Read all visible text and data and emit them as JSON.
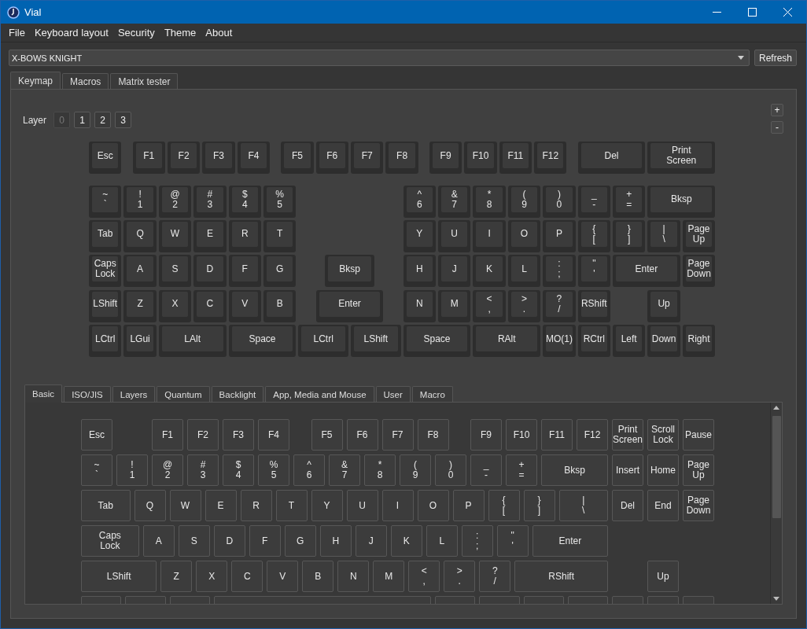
{
  "window": {
    "title": "Vial"
  },
  "menu": [
    "File",
    "Keyboard layout",
    "Security",
    "Theme",
    "About"
  ],
  "keyboard_select": {
    "value": "X-BOWS KNIGHT"
  },
  "refresh_button": "Refresh",
  "tabs": [
    {
      "label": "Keymap",
      "selected": true
    },
    {
      "label": "Macros",
      "selected": false
    },
    {
      "label": "Matrix tester",
      "selected": false
    }
  ],
  "layer_label": "Layer",
  "layers": [
    {
      "label": "0",
      "selected": true
    },
    {
      "label": "1",
      "selected": false
    },
    {
      "label": "2",
      "selected": false
    },
    {
      "label": "3",
      "selected": false
    }
  ],
  "layer_buttons": [
    "+",
    "-"
  ],
  "keymap": [
    [
      "Esc",
      "F1",
      "F2",
      "F3",
      "F4",
      "F5",
      "F6",
      "F7",
      "F8",
      "F9",
      "F10",
      "F11",
      "F12",
      "Del",
      "Print\nScreen"
    ],
    [
      "~\n`",
      "!\n1",
      "@\n2",
      "#\n3",
      "$\n4",
      "%\n5",
      "^\n6",
      "&\n7",
      "*\n8",
      "(\n9",
      ")\n0",
      "_\n-",
      "+\n=",
      "Bksp"
    ],
    [
      "Tab",
      "Q",
      "W",
      "E",
      "R",
      "T",
      "Y",
      "U",
      "I",
      "O",
      "P",
      "{\n[",
      "}\n]",
      "|\n\\",
      "Page\nUp"
    ],
    [
      "Caps\nLock",
      "A",
      "S",
      "D",
      "F",
      "G",
      "Bksp",
      "H",
      "J",
      "K",
      "L",
      ":\n;",
      "\"\n'",
      "Enter",
      "Page\nDown"
    ],
    [
      "LShift",
      "Z",
      "X",
      "C",
      "V",
      "B",
      "Enter",
      "N",
      "M",
      "<\n,",
      ">\n.",
      "?\n/",
      "RShift",
      "Up"
    ],
    [
      "LCtrl",
      "LGui",
      "LAlt",
      "Space",
      "LCtrl",
      "LShift",
      "Space",
      "RAlt",
      "MO(1)",
      "RCtrl",
      "Left",
      "Down",
      "Right"
    ]
  ],
  "keycode_tabs": [
    {
      "label": "Basic",
      "selected": true
    },
    {
      "label": "ISO/JIS",
      "selected": false
    },
    {
      "label": "Layers",
      "selected": false
    },
    {
      "label": "Quantum",
      "selected": false
    },
    {
      "label": "Backlight",
      "selected": false
    },
    {
      "label": "App, Media and Mouse",
      "selected": false
    },
    {
      "label": "User",
      "selected": false
    },
    {
      "label": "Macro",
      "selected": false
    }
  ],
  "basic_keys": [
    [
      "Esc",
      "F1",
      "F2",
      "F3",
      "F4",
      "F5",
      "F6",
      "F7",
      "F8",
      "F9",
      "F10",
      "F11",
      "F12",
      "Print\nScreen",
      "Scroll\nLock",
      "Pause"
    ],
    [
      "~\n`",
      "!\n1",
      "@\n2",
      "#\n3",
      "$\n4",
      "%\n5",
      "^\n6",
      "&\n7",
      "*\n8",
      "(\n9",
      ")\n0",
      "_\n-",
      "+\n=",
      "Bksp",
      "Insert",
      "Home",
      "Page\nUp"
    ],
    [
      "Tab",
      "Q",
      "W",
      "E",
      "R",
      "T",
      "Y",
      "U",
      "I",
      "O",
      "P",
      "{\n[",
      "}\n]",
      "|\n\\",
      "Del",
      "End",
      "Page\nDown"
    ],
    [
      "Caps\nLock",
      "A",
      "S",
      "D",
      "F",
      "G",
      "H",
      "J",
      "K",
      "L",
      ":\n;",
      "\"\n'",
      "Enter"
    ],
    [
      "LShift",
      "Z",
      "X",
      "C",
      "V",
      "B",
      "N",
      "M",
      "<\n,",
      ">\n.",
      "?\n/",
      "RShift",
      "Up"
    ]
  ]
}
